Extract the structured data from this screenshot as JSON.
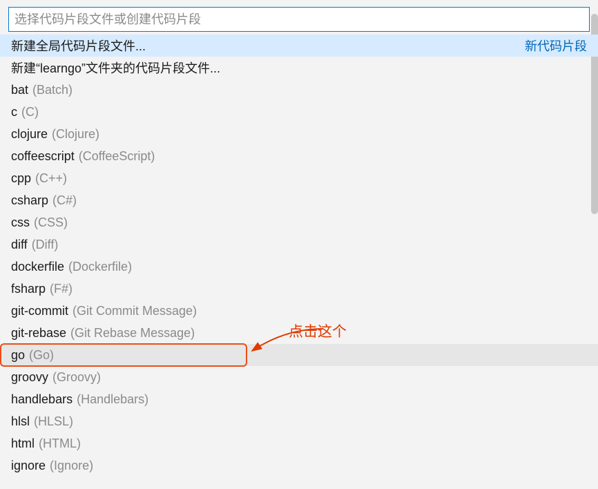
{
  "search_placeholder": "选择代码片段文件或创建代码片段",
  "header_item": {
    "label": "新建全局代码片段文件...",
    "right": "新代码片段"
  },
  "folder_item": {
    "label": "新建“learngo”文件夹的代码片段文件..."
  },
  "languages": [
    {
      "name": "bat",
      "desc": "(Batch)"
    },
    {
      "name": "c",
      "desc": "(C)"
    },
    {
      "name": "clojure",
      "desc": "(Clojure)"
    },
    {
      "name": "coffeescript",
      "desc": "(CoffeeScript)"
    },
    {
      "name": "cpp",
      "desc": "(C++)"
    },
    {
      "name": "csharp",
      "desc": "(C#)"
    },
    {
      "name": "css",
      "desc": "(CSS)"
    },
    {
      "name": "diff",
      "desc": "(Diff)"
    },
    {
      "name": "dockerfile",
      "desc": "(Dockerfile)"
    },
    {
      "name": "fsharp",
      "desc": "(F#)"
    },
    {
      "name": "git-commit",
      "desc": "(Git Commit Message)"
    },
    {
      "name": "git-rebase",
      "desc": "(Git Rebase Message)"
    },
    {
      "name": "go",
      "desc": "(Go)"
    },
    {
      "name": "groovy",
      "desc": "(Groovy)"
    },
    {
      "name": "handlebars",
      "desc": "(Handlebars)"
    },
    {
      "name": "hlsl",
      "desc": "(HLSL)"
    },
    {
      "name": "html",
      "desc": "(HTML)"
    },
    {
      "name": "ignore",
      "desc": "(Ignore)"
    }
  ],
  "annotation_text": "点击这个"
}
